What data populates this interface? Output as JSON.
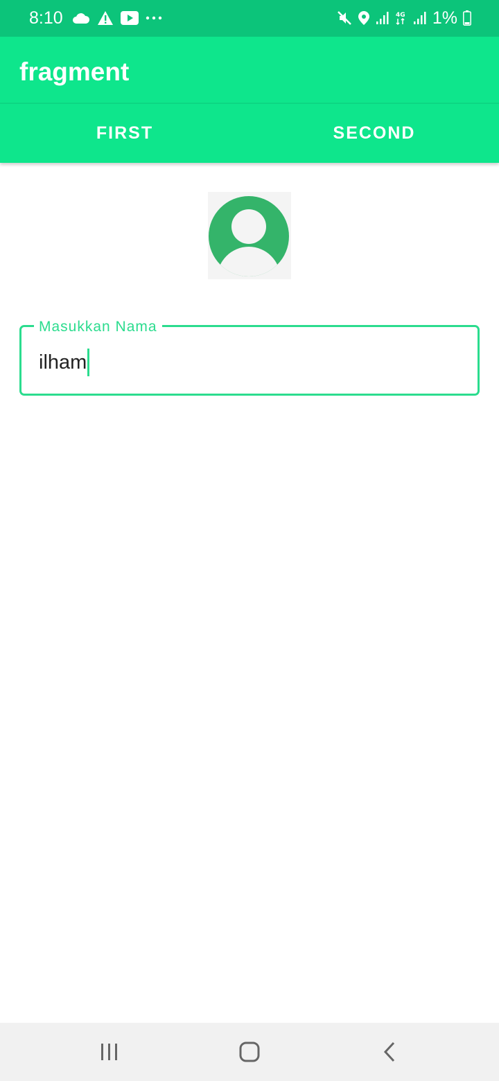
{
  "status_bar": {
    "time": "8:10",
    "battery": "1%",
    "background": "#0cc47a",
    "left_icons": [
      "cloud-icon",
      "warning-icon",
      "youtube-icon",
      "more-dots-icon"
    ],
    "right_icons": [
      "mute-icon",
      "location-icon",
      "signal-icon",
      "network-4g-icon",
      "signal-icon",
      "battery-icon"
    ]
  },
  "app_bar": {
    "title": "fragment",
    "background": "#0ee68c"
  },
  "tabs": [
    {
      "label": "FIRST"
    },
    {
      "label": "SECOND"
    }
  ],
  "profile": {
    "avatar_icon": "person-avatar-icon",
    "avatar_color": "#34b46a"
  },
  "name_field": {
    "label": "Masukkan Nama",
    "value": "ilham",
    "accent": "#2bdc8e"
  },
  "nav_bar": {
    "buttons": [
      "recent-apps-icon",
      "home-icon",
      "back-icon"
    ]
  }
}
